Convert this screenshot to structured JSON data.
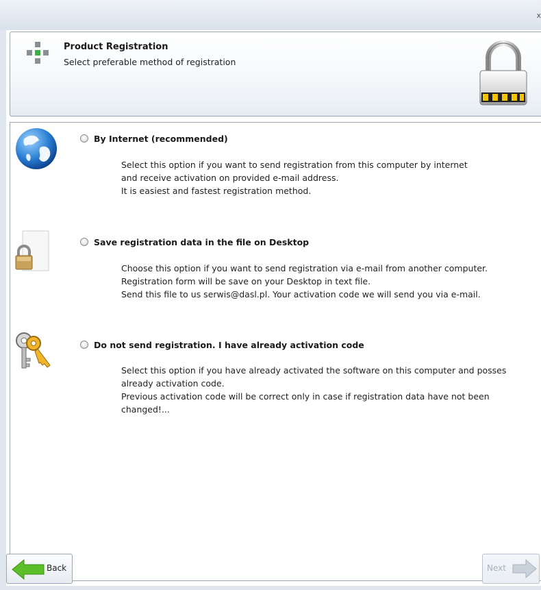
{
  "window": {
    "close_label": "x"
  },
  "header": {
    "title": "Product Registration",
    "subtitle": "Select preferable method of registration"
  },
  "options": [
    {
      "title": "By Internet (recommended)",
      "icon": "globe-icon",
      "selected": false,
      "lines": [
        "Select this option if you want to send registration from this computer by internet",
        "and receive activation on provided e-mail address.",
        "It is easiest and fastest registration method."
      ]
    },
    {
      "title": "Save registration data in the file on Desktop",
      "icon": "document-lock-icon",
      "selected": false,
      "lines": [
        "Choose this option if you want to send registration via e-mail from another computer.",
        "Registration form will be save on your Desktop in text file.",
        "Send this file to us serwis@dasl.pl. Your activation code we will send you via e-mail."
      ]
    },
    {
      "title": "Do not send registration. I have already activation code",
      "icon": "keys-icon",
      "selected": false,
      "lines": [
        "Select this option if you have already activated the software on this computer and posses",
        "already activation code.",
        "Previous activation code will be correct only in case if registration data have not been",
        "changed!..."
      ]
    }
  ],
  "buttons": {
    "back": "Back",
    "next": "Next",
    "next_enabled": false
  },
  "colors": {
    "arrow_green": "#5cbf2a",
    "plus_green": "#3cb043",
    "plus_gray": "#8a8f95",
    "disabled_text": "#a7b1bb"
  }
}
